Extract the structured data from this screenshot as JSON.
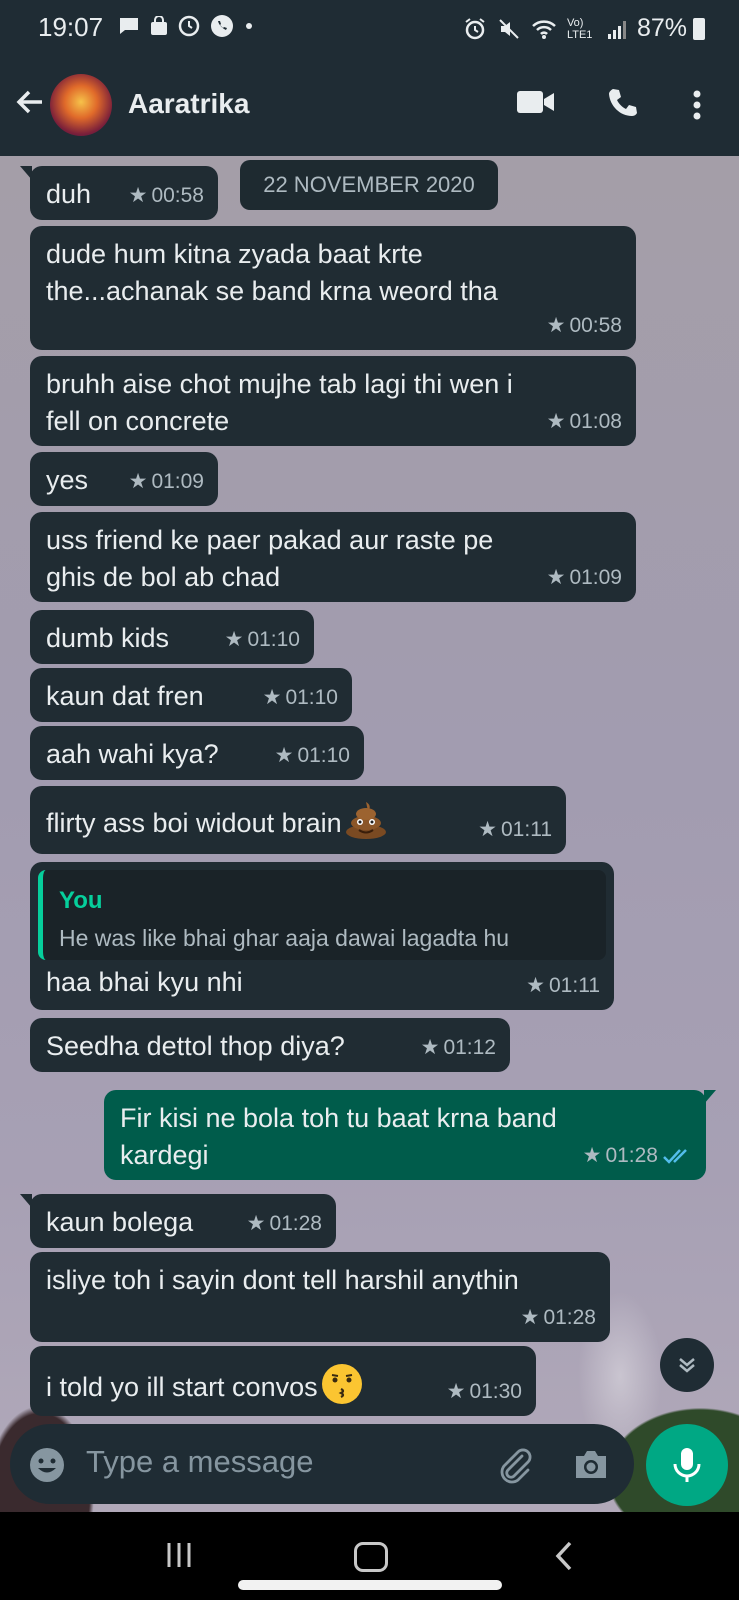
{
  "status_bar": {
    "time": "19:07",
    "network": "Vo) LTE1",
    "battery": "87%"
  },
  "header": {
    "contact_name": "Aaratrika"
  },
  "date_chip": "22 NOVEMBER 2020",
  "messages": [
    {
      "dir": "in",
      "text": "duh",
      "time": "00:58"
    },
    {
      "dir": "in",
      "text_lines": [
        "dude hum kitna zyada baat krte",
        "the...achanak se band krna weord tha"
      ],
      "time": "00:58"
    },
    {
      "dir": "in",
      "text_lines": [
        "bruhh aise chot mujhe tab lagi thi wen i",
        "fell on concrete"
      ],
      "time": "01:08"
    },
    {
      "dir": "in",
      "text": "yes",
      "time": "01:09"
    },
    {
      "dir": "in",
      "text_lines": [
        "uss friend ke paer pakad aur raste pe",
        "ghis de bol ab chad"
      ],
      "time": "01:09"
    },
    {
      "dir": "in",
      "text": "dumb kids",
      "time": "01:10"
    },
    {
      "dir": "in",
      "text": "kaun dat fren",
      "time": "01:10"
    },
    {
      "dir": "in",
      "text": "aah wahi kya?",
      "time": "01:10"
    },
    {
      "dir": "in",
      "text": "flirty ass boi widout brain",
      "emoji": "💩",
      "time": "01:11"
    },
    {
      "dir": "in",
      "quote_author": "You",
      "quote_text": "He was like bhai ghar aaja dawai lagadta hu",
      "text": "haa bhai kyu nhi",
      "time": "01:11"
    },
    {
      "dir": "in",
      "text": "Seedha dettol thop diya?",
      "time": "01:12"
    },
    {
      "dir": "out",
      "text_lines": [
        "Fir kisi ne bola toh tu baat krna band",
        "kardegi"
      ],
      "time": "01:28"
    },
    {
      "dir": "in",
      "text": "kaun bolega",
      "time": "01:28"
    },
    {
      "dir": "in",
      "text": "isliye toh i sayin dont tell harshil anythin",
      "time": "01:28"
    },
    {
      "dir": "in",
      "text": "i told yo ill start convos",
      "emoji": "😗",
      "time": "01:30"
    }
  ],
  "composer": {
    "placeholder": "Type a message"
  },
  "colors": {
    "incoming": "#202c33",
    "outgoing": "#005c4b",
    "accent": "#00a884",
    "read_ticks": "#53bdeb"
  }
}
